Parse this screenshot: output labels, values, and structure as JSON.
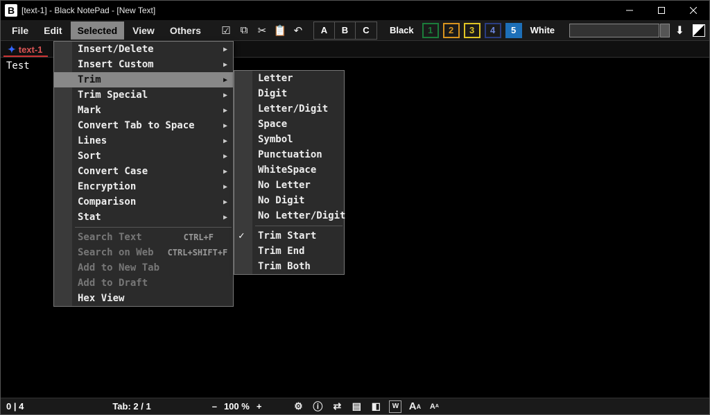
{
  "window": {
    "title": "[text-1] - Black NotePad - [New Text]",
    "app_icon_letter": "B"
  },
  "menubar": {
    "items": [
      "File",
      "Edit",
      "Selected",
      "View",
      "Others"
    ],
    "open_index": 2,
    "segment_buttons": [
      "A",
      "B",
      "C"
    ],
    "mode_black": "Black",
    "mode_white": "White",
    "num_buttons": [
      "1",
      "2",
      "3",
      "4",
      "5"
    ]
  },
  "tabs": {
    "items": [
      {
        "label": "text-1"
      }
    ],
    "active": 0
  },
  "editor": {
    "content": "Test"
  },
  "selected_menu": {
    "items": [
      {
        "label": "Insert/Delete",
        "sub": true
      },
      {
        "label": "Insert Custom",
        "sub": true
      },
      {
        "label": "Trim",
        "sub": true,
        "highlight": true
      },
      {
        "label": "Trim Special",
        "sub": true
      },
      {
        "label": "Mark",
        "sub": true
      },
      {
        "label": "Convert Tab to Space",
        "sub": true
      },
      {
        "label": "Lines",
        "sub": true
      },
      {
        "label": "Sort",
        "sub": true
      },
      {
        "label": "Convert Case",
        "sub": true
      },
      {
        "label": "Encryption",
        "sub": true
      },
      {
        "label": "Comparison",
        "sub": true
      },
      {
        "label": "Stat",
        "sub": true
      },
      {
        "sep": true
      },
      {
        "label": "Search Text",
        "shortcut": "CTRL+F",
        "disabled": true
      },
      {
        "label": "Search on Web",
        "shortcut": "CTRL+SHIFT+F",
        "disabled": true
      },
      {
        "label": "Add to New Tab",
        "disabled": true
      },
      {
        "label": "Add to Draft",
        "disabled": true
      },
      {
        "label": "Hex View"
      }
    ]
  },
  "trim_submenu": {
    "items": [
      {
        "label": "Letter"
      },
      {
        "label": "Digit"
      },
      {
        "label": "Letter/Digit"
      },
      {
        "label": "Space"
      },
      {
        "label": "Symbol"
      },
      {
        "label": "Punctuation"
      },
      {
        "label": "WhiteSpace"
      },
      {
        "label": "No Letter"
      },
      {
        "label": "No Digit"
      },
      {
        "label": "No Letter/Digit"
      },
      {
        "sep": true
      },
      {
        "label": "Trim Start",
        "checked": true
      },
      {
        "label": "Trim End"
      },
      {
        "label": "Trim Both"
      }
    ]
  },
  "statusbar": {
    "position": "0 | 4",
    "tab_info": "Tab: 2 / 1",
    "zoom_minus": "–",
    "zoom_value": "100 %",
    "zoom_plus": "+"
  }
}
